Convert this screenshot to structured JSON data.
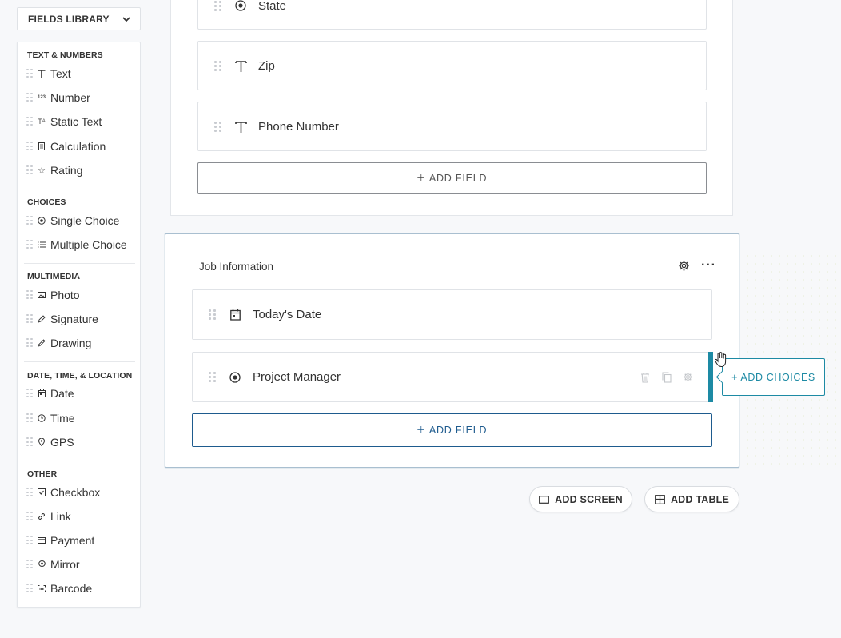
{
  "library": {
    "title": "FIELDS LIBRARY",
    "sections": [
      {
        "title": "TEXT & NUMBERS",
        "items": [
          {
            "label": "Text",
            "icon": "text-icon"
          },
          {
            "label": "Number",
            "icon": "number-icon"
          },
          {
            "label": "Static Text",
            "icon": "static-text-icon"
          },
          {
            "label": "Calculation",
            "icon": "calculator-icon"
          },
          {
            "label": "Rating",
            "icon": "star-icon"
          }
        ]
      },
      {
        "title": "CHOICES",
        "items": [
          {
            "label": "Single Choice",
            "icon": "radio-icon"
          },
          {
            "label": "Multiple Choice",
            "icon": "checklist-icon"
          }
        ]
      },
      {
        "title": "MULTIMEDIA",
        "items": [
          {
            "label": "Photo",
            "icon": "photo-icon"
          },
          {
            "label": "Signature",
            "icon": "pen-icon"
          },
          {
            "label": "Drawing",
            "icon": "pencil-icon"
          }
        ]
      },
      {
        "title": "DATE, TIME, & LOCATION",
        "items": [
          {
            "label": "Date",
            "icon": "calendar-icon"
          },
          {
            "label": "Time",
            "icon": "clock-icon"
          },
          {
            "label": "GPS",
            "icon": "location-pin-icon"
          }
        ]
      },
      {
        "title": "OTHER",
        "items": [
          {
            "label": "Checkbox",
            "icon": "checkbox-icon"
          },
          {
            "label": "Link",
            "icon": "link-icon"
          },
          {
            "label": "Payment",
            "icon": "credit-card-icon"
          },
          {
            "label": "Mirror",
            "icon": "mirror-icon"
          },
          {
            "label": "Barcode",
            "icon": "barcode-icon"
          }
        ]
      }
    ]
  },
  "address_section": {
    "fields": [
      {
        "label": "State",
        "icon": "radio-icon"
      },
      {
        "label": "Zip",
        "icon": "text-icon"
      },
      {
        "label": "Phone Number",
        "icon": "text-icon"
      }
    ],
    "add_field_label": "ADD FIELD"
  },
  "job_section": {
    "title": "Job Information",
    "fields": [
      {
        "label": "Today's Date",
        "icon": "calendar-icon"
      },
      {
        "label": "Project Manager",
        "icon": "radio-icon"
      }
    ],
    "add_field_label": "ADD FIELD",
    "add_choices_label": "+ ADD CHOICES"
  },
  "footer_buttons": {
    "add_screen": "ADD SCREEN",
    "add_table": "ADD TABLE"
  },
  "colors": {
    "accent": "#1d8aa4",
    "link_blue": "#1e5b8e"
  }
}
